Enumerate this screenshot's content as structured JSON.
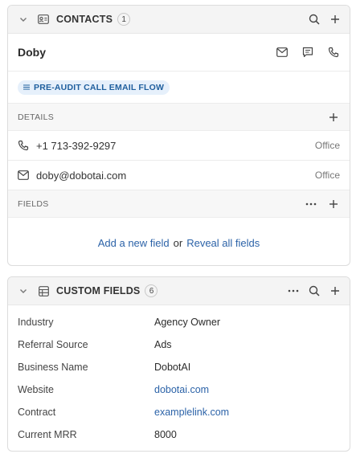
{
  "contacts": {
    "title": "CONTACTS",
    "count": "1",
    "contact": {
      "name": "Doby",
      "tag": "PRE-AUDIT CALL EMAIL FLOW"
    },
    "details": {
      "label": "DETAILS",
      "items": [
        {
          "icon": "phone-icon",
          "value": "+1 713-392-9297",
          "type": "Office"
        },
        {
          "icon": "mail-icon",
          "value": "doby@dobotai.com",
          "type": "Office"
        }
      ]
    },
    "fields": {
      "label": "FIELDS",
      "add_link": "Add a new field",
      "or_text": "or",
      "reveal_link": "Reveal all fields"
    }
  },
  "custom_fields": {
    "title": "CUSTOM FIELDS",
    "count": "6",
    "rows": [
      {
        "label": "Industry",
        "value": "Agency Owner"
      },
      {
        "label": "Referral Source",
        "value": "Ads"
      },
      {
        "label": "Business Name",
        "value": "DobotAI"
      },
      {
        "label": "Website",
        "value": "dobotai.com"
      },
      {
        "label": "Contract",
        "value": "examplelink.com"
      },
      {
        "label": "Current MRR",
        "value": "8000"
      }
    ]
  },
  "colors": {
    "link": "#2c63a8",
    "tag_bg": "#e6f0fb",
    "tag_text": "#1f5f9e",
    "header_bg": "#f4f4f4"
  }
}
